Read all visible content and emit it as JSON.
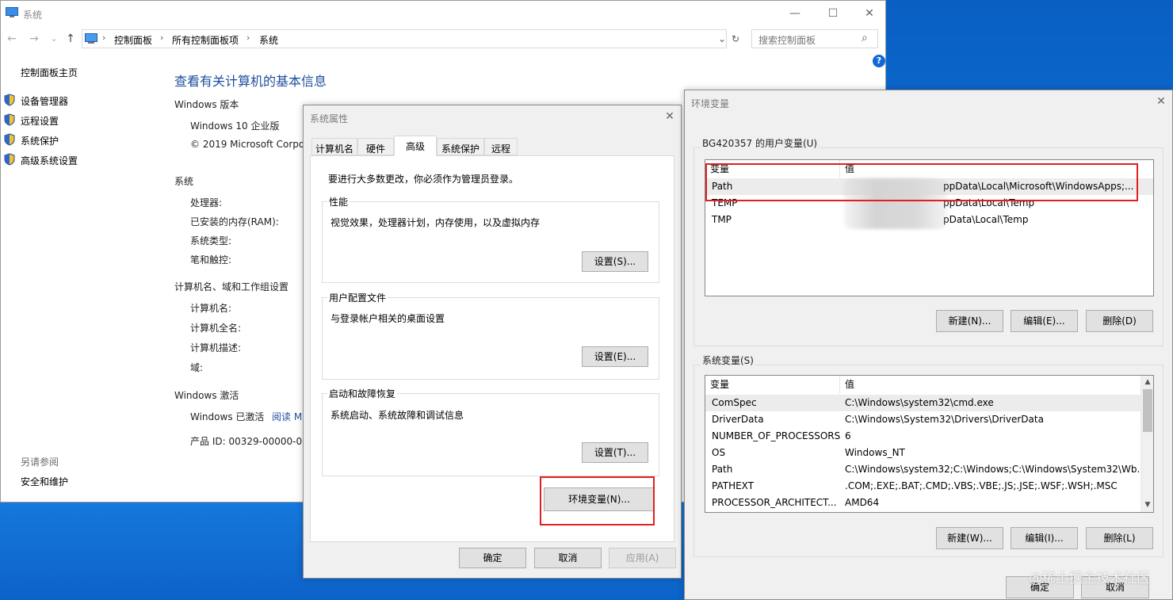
{
  "system_window": {
    "title": "系统",
    "controls": {
      "minimize": "—",
      "maximize": "☐",
      "close": "✕"
    },
    "nav": {
      "back": "←",
      "forward": "→",
      "dropdown": "⌄",
      "up": "↑"
    },
    "breadcrumb": [
      "控制面板",
      "所有控制面板项",
      "系统"
    ],
    "breadcrumb_sep": "›",
    "address_dropdown": "⌄",
    "refresh": "↻",
    "search_placeholder": "搜索控制面板",
    "search_icon": "⌕",
    "help": "?",
    "sidebar": {
      "home": "控制面板主页",
      "items": [
        "设备管理器",
        "远程设置",
        "系统保护",
        "高级系统设置"
      ],
      "see_also_title": "另请参阅",
      "see_also_item": "安全和维护"
    },
    "main_title": "查看有关计算机的基本信息",
    "edition": {
      "heading": "Windows 版本",
      "name": "Windows 10 企业版",
      "copyright": "© 2019 Microsoft Corpo"
    },
    "system": {
      "heading": "系统",
      "labels": [
        "处理器:",
        "已安装的内存(RAM):",
        "系统类型:",
        "笔和触控:"
      ]
    },
    "computer": {
      "heading": "计算机名、域和工作组设置",
      "labels": [
        "计算机名:",
        "计算机全名:",
        "计算机描述:",
        "域:"
      ]
    },
    "activation": {
      "heading": "Windows 激活",
      "status": "Windows 已激活",
      "link": "阅读 M",
      "product_id": "产品 ID: 00329-00000-00"
    }
  },
  "system_properties": {
    "title": "系统属性",
    "close": "✕",
    "tabs": [
      "计算机名",
      "硬件",
      "高级",
      "系统保护",
      "远程"
    ],
    "active_tab": "高级",
    "note": "要进行大多数更改，你必须作为管理员登录。",
    "groups": [
      {
        "title": "性能",
        "desc": "视觉效果，处理器计划，内存使用，以及虚拟内存",
        "button": "设置(S)..."
      },
      {
        "title": "用户配置文件",
        "desc": "与登录帐户相关的桌面设置",
        "button": "设置(E)..."
      },
      {
        "title": "启动和故障恢复",
        "desc": "系统启动、系统故障和调试信息",
        "button": "设置(T)..."
      }
    ],
    "env_button": "环境变量(N)...",
    "ok": "确定",
    "cancel": "取消",
    "apply": "应用(A)"
  },
  "env_variables": {
    "title": "环境变量",
    "close": "✕",
    "user_group_title": "BG420357 的用户变量(U)",
    "columns": [
      "变量",
      "值"
    ],
    "user_vars": [
      {
        "name": "Path",
        "value": "ppData\\Local\\Microsoft\\WindowsApps;..."
      },
      {
        "name": "TEMP",
        "value": "ppData\\Local\\Temp"
      },
      {
        "name": "TMP",
        "value": "pData\\Local\\Temp"
      }
    ],
    "user_buttons": [
      "新建(N)...",
      "编辑(E)...",
      "删除(D)"
    ],
    "system_group_title": "系统变量(S)",
    "system_vars": [
      {
        "name": "ComSpec",
        "value": "C:\\Windows\\system32\\cmd.exe"
      },
      {
        "name": "DriverData",
        "value": "C:\\Windows\\System32\\Drivers\\DriverData"
      },
      {
        "name": "NUMBER_OF_PROCESSORS",
        "value": "6"
      },
      {
        "name": "OS",
        "value": "Windows_NT"
      },
      {
        "name": "Path",
        "value": "C:\\Windows\\system32;C:\\Windows;C:\\Windows\\System32\\Wb..."
      },
      {
        "name": "PATHEXT",
        "value": ".COM;.EXE;.BAT;.CMD;.VBS;.VBE;.JS;.JSE;.WSF;.WSH;.MSC"
      },
      {
        "name": "PROCESSOR_ARCHITECT...",
        "value": "AMD64"
      }
    ],
    "system_buttons": [
      "新建(W)...",
      "编辑(I)...",
      "删除(L)"
    ],
    "ok": "确定",
    "cancel": "取消",
    "scroll_up": "▲",
    "scroll_down": "▼"
  },
  "watermark": "@稀土掘金技术社区",
  "colors": {
    "highlight_box": "#e02020",
    "link": "#1e4e9e",
    "desktop": "#0b6fd8"
  }
}
